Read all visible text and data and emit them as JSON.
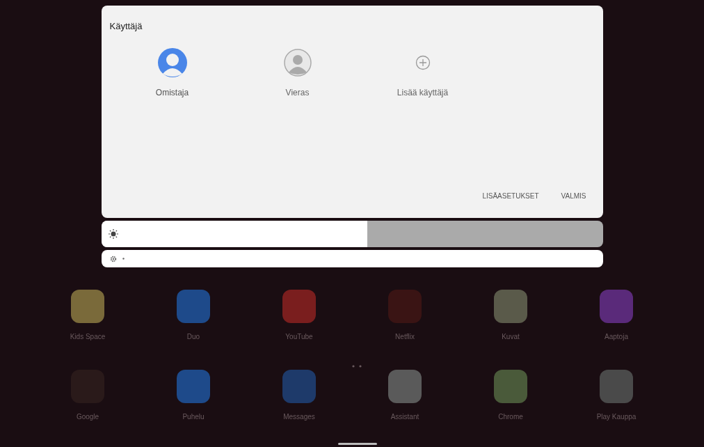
{
  "user_panel": {
    "title": "Käyttäjä",
    "users": [
      {
        "kind": "owner",
        "label": "Omistaja",
        "selected": true
      },
      {
        "kind": "guest",
        "label": "Vieras",
        "selected": false
      },
      {
        "kind": "add",
        "label": "Lisää käyttäjä",
        "selected": false
      }
    ],
    "buttons": [
      "LISÄASETUKSET",
      "VALMIS"
    ]
  },
  "brightness": {
    "level": 0.53
  },
  "home_apps": [
    {
      "label": "Kids Space",
      "color": "#7a6a3a"
    },
    {
      "label": "Duo",
      "color": "#1e4a8a"
    },
    {
      "label": "YouTube",
      "color": "#7a1e1e"
    },
    {
      "label": "Netflix",
      "color": "#3a1414"
    },
    {
      "label": "Kuvat",
      "color": "#5a5a4a"
    },
    {
      "label": "Aaptoja",
      "color": "#5a2a7a"
    },
    {
      "label": "Google",
      "color": "#2a1a1a"
    },
    {
      "label": "Puhelu",
      "color": "#1e4a8a"
    },
    {
      "label": "Messages",
      "color": "#1e3a6a"
    },
    {
      "label": "Assistant",
      "color": "#5a5a5a"
    },
    {
      "label": "Chrome",
      "color": "#4a5a3a"
    },
    {
      "label": "Play Kauppa",
      "color": "#4a4a4a"
    }
  ]
}
